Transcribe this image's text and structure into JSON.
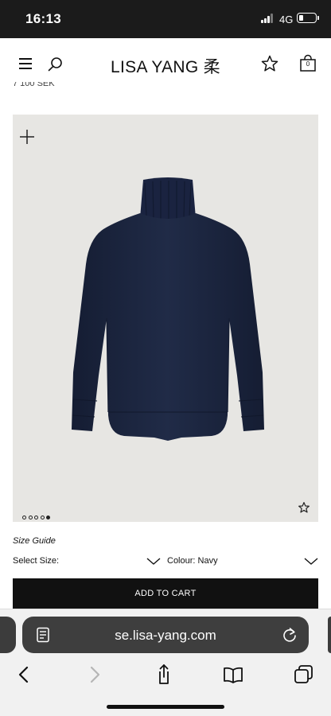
{
  "status_bar": {
    "time": "16:13",
    "network": "4G",
    "battery_level": 0.25
  },
  "header": {
    "brand": "LISA YANG 柔",
    "menu_icon": "hamburger-icon",
    "search_icon": "search-icon",
    "wishlist_icon": "star-icon",
    "cart_icon": "bag-icon",
    "cart_count": "0"
  },
  "partial_price_text": "7 100 SEK",
  "product": {
    "image_description_icon": "sweater",
    "sweater_color": "#1c2640",
    "background_color": "#e7e6e3",
    "carousel": {
      "total": 5,
      "active_index": 4
    },
    "zoom_icon": "plus-icon",
    "favorite_icon": "star-outline-icon"
  },
  "options": {
    "size_guide": "Size Guide",
    "size_label": "Select  Size:",
    "colour_label": "Colour: Navy",
    "add_to_cart": "ADD TO CART"
  },
  "browser": {
    "url": "se.lisa-yang.com",
    "reader_icon": "reader-mode-icon",
    "reload_icon": "reload-icon",
    "back_icon": "back-chevron-icon",
    "forward_icon": "forward-chevron-icon",
    "share_icon": "share-icon",
    "bookmarks_icon": "book-icon",
    "tabs_icon": "tabs-icon"
  }
}
